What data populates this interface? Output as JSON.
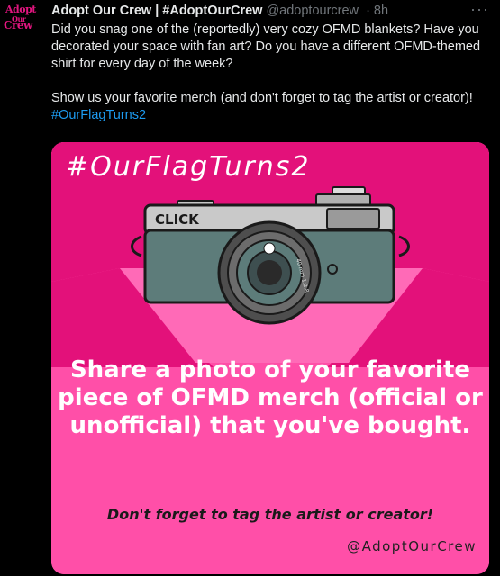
{
  "account": {
    "avatar_text": "Adopt Our Crew",
    "name": "Adopt Our Crew | #AdoptOurCrew",
    "handle": "@adoptourcrew",
    "time": "· 8h",
    "more_label": "···"
  },
  "tweet": {
    "paragraph1": "Did you snag one of the (reportedly) very cozy OFMD blankets? Have you decorated your space with fan art? Do you have a different OFMD-themed shirt for every day of the week?",
    "paragraph2": "Show us your favorite merch (and don't forget to tag the artist or creator)!",
    "hashtag": "#OurFlagTurns2"
  },
  "image": {
    "tag": "#OurFlagTurns2",
    "camera_label": "CLICK",
    "lens_text": "40 mm 1:2.8",
    "message": "Share a photo of your favorite piece of OFMD merch (official or unofficial) that you've bought.",
    "cta": "Don't forget to tag the artist or creator!",
    "credit": "@AdoptOurCrew"
  },
  "colors": {
    "background": "#000000",
    "text": "#e7e9ea",
    "muted": "#71767b",
    "link": "#1d9bf0",
    "card_pink": "#ff4fa8",
    "card_magenta": "#e3117a",
    "camera_body": "#5d7c7a"
  },
  "icons": {
    "more": "more-dots-icon"
  }
}
